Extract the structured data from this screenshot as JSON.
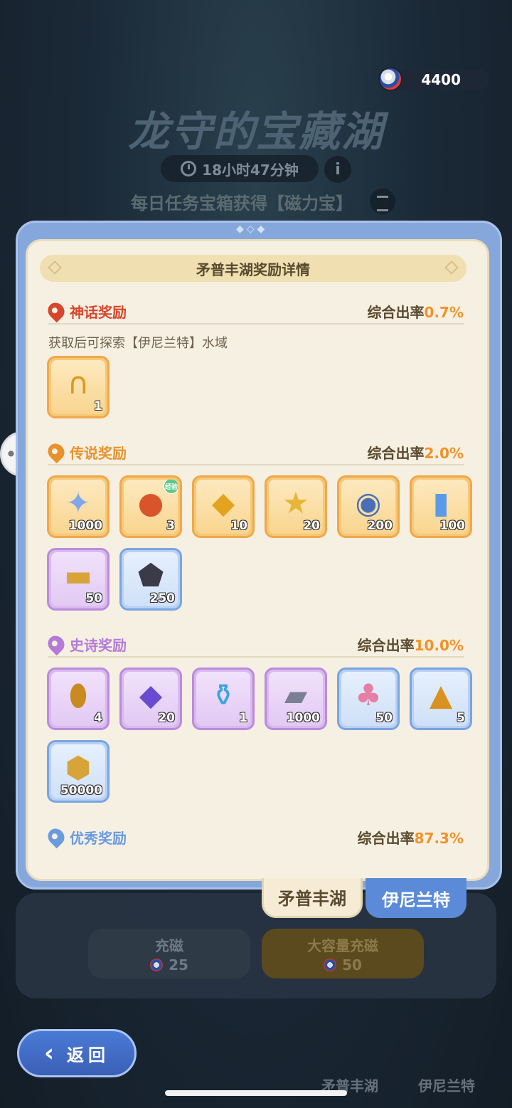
{
  "currency": {
    "amount": "4400",
    "icon": "magnet-coin-icon"
  },
  "event": {
    "title": "龙守的宝藏湖",
    "timer": "18小时47分钟",
    "task_text": "每日任务宝箱获得【磁力宝】"
  },
  "charge": {
    "small_label": "充磁",
    "small_cost": "25",
    "big_label": "大容量充磁",
    "big_cost": "50"
  },
  "back_label": "返回",
  "bottom_tabs": {
    "lake_a": "矛普丰湖",
    "lake_b": "伊尼兰特"
  },
  "modal": {
    "title": "矛普丰湖奖励详情",
    "tabs": {
      "active": "矛普丰湖",
      "inactive": "伊尼兰特"
    },
    "sections": {
      "mythic": {
        "label": "神话奖励",
        "rate_label": "综合出率",
        "rate": "0.7%",
        "color": "#d9452b",
        "note": "获取后可探索【伊尼兰特】水域",
        "items": [
          {
            "icon": "golden-magnet-icon",
            "qty": "1"
          }
        ]
      },
      "legend": {
        "label": "传说奖励",
        "rate_label": "综合出率",
        "rate": "2.0%",
        "color": "#e8922e",
        "items": [
          {
            "icon": "crystal-star-icon",
            "qty": "1000"
          },
          {
            "icon": "fire-spirit-icon",
            "qty": "3",
            "tag": "经验"
          },
          {
            "icon": "amber-gem-icon",
            "qty": "10"
          },
          {
            "icon": "gold-star-shard-icon",
            "qty": "20"
          },
          {
            "icon": "portal-orb-icon",
            "qty": "200"
          },
          {
            "icon": "energy-canister-icon",
            "qty": "100"
          },
          {
            "icon": "golden-tablet-icon",
            "qty": "50"
          },
          {
            "icon": "magma-ore-icon",
            "qty": "250"
          }
        ]
      },
      "epic": {
        "label": "史诗奖励",
        "rate_label": "综合出率",
        "rate": "10.0%",
        "color": "#b57ad8",
        "items": [
          {
            "icon": "amber-egg-icon",
            "qty": "4"
          },
          {
            "icon": "violet-crystal-icon",
            "qty": "20"
          },
          {
            "icon": "blue-potion-icon",
            "qty": "1"
          },
          {
            "icon": "iron-ingot-icon",
            "qty": "1000"
          },
          {
            "icon": "paw-icon",
            "qty": "50"
          },
          {
            "icon": "amber-shard-icon",
            "qty": "5"
          },
          {
            "icon": "gold-coin-icon",
            "qty": "50000"
          }
        ]
      },
      "excellent": {
        "label": "优秀奖励",
        "rate_label": "综合出率",
        "rate": "87.3%",
        "color": "#6a9ae0"
      }
    }
  }
}
